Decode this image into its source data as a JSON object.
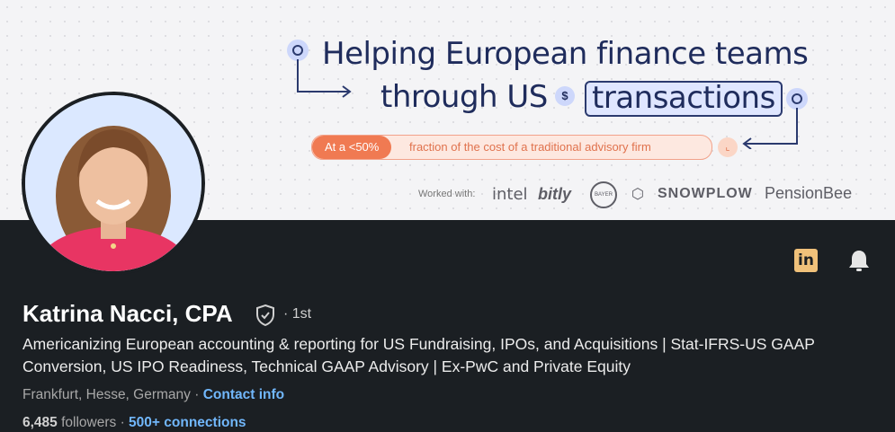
{
  "banner": {
    "headline_line1": "Helping European finance teams",
    "headline_line2_prefix": "through US",
    "headline_highlight": "transactions",
    "dollar_symbol": "$",
    "pill_strong": "At a <50%",
    "pill_rest": "fraction of the cost of a traditional advisory firm",
    "worked_with_label": "Worked with:",
    "logos": [
      "intel",
      "bitly",
      "BAYER",
      "SNOWPLOW",
      "PensionBee"
    ],
    "accent_color": "#f07a52",
    "headline_color": "#1f2c5c"
  },
  "profile": {
    "name": "Katrina Nacci, CPA",
    "degree": "· 1st",
    "headline": "Americanizing European accounting & reporting for US Fundraising, IPOs, and Acquisitions | Stat-IFRS-US GAAP Conversion, US IPO Readiness, Technical GAAP Advisory | Ex-PwC and Private Equity",
    "location": "Frankfurt, Hesse, Germany",
    "location_sep": " · ",
    "contact_info": "Contact info",
    "followers_count": "6,485",
    "followers_label": " followers",
    "sep": " · ",
    "connections": "500+ connections",
    "linkedin_badge": "in",
    "link_color": "#71b7fb"
  }
}
